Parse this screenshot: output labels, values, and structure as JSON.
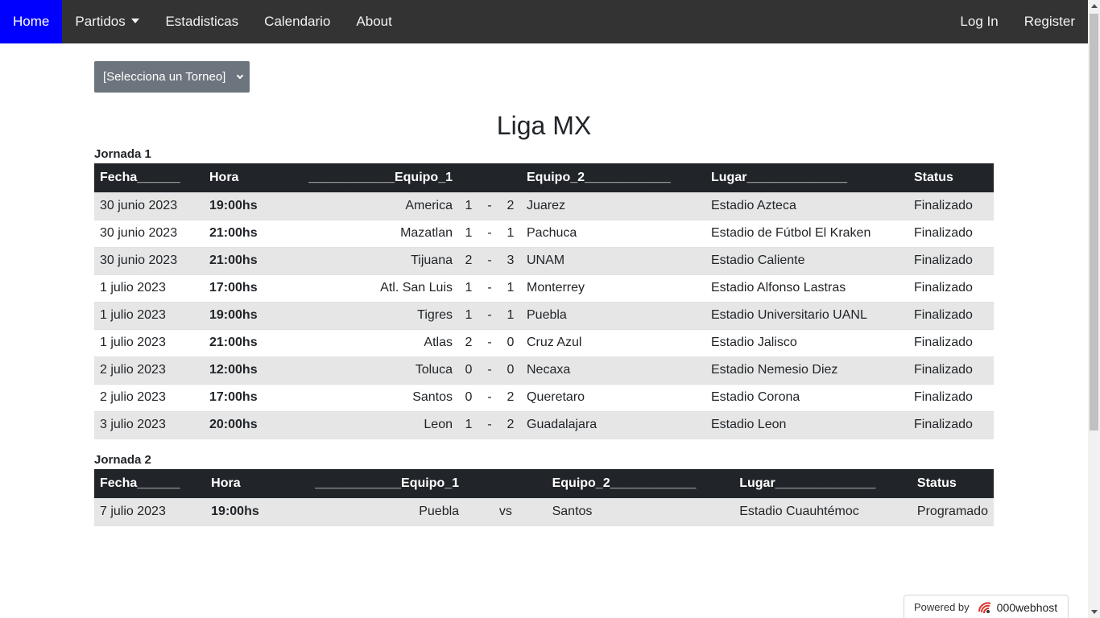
{
  "navbar": {
    "home": "Home",
    "partidos": "Partidos",
    "estadisticas": "Estadisticas",
    "calendario": "Calendario",
    "about": "About",
    "login": "Log In",
    "register": "Register"
  },
  "torneo_select": {
    "value": "[Selecciona un Torneo]"
  },
  "title": "Liga MX",
  "headers": {
    "fecha": "Fecha______",
    "hora": "Hora",
    "equipo1": "____________Equipo_1",
    "equipo2": "Equipo_2____________",
    "lugar": "Lugar______________",
    "status": "Status"
  },
  "jornadas": [
    {
      "label": "Jornada 1",
      "rows": [
        {
          "fecha": "30 junio 2023",
          "hora": "19:00hs",
          "equipo1": "America",
          "g1": "1",
          "sep": "-",
          "g2": "2",
          "equipo2": "Juarez",
          "lugar": "Estadio Azteca",
          "status": "Finalizado"
        },
        {
          "fecha": "30 junio 2023",
          "hora": "21:00hs",
          "equipo1": "Mazatlan",
          "g1": "1",
          "sep": "-",
          "g2": "1",
          "equipo2": "Pachuca",
          "lugar": "Estadio de Fútbol El Kraken",
          "status": "Finalizado"
        },
        {
          "fecha": "30 junio 2023",
          "hora": "21:00hs",
          "equipo1": "Tijuana",
          "g1": "2",
          "sep": "-",
          "g2": "3",
          "equipo2": "UNAM",
          "lugar": "Estadio Caliente",
          "status": "Finalizado"
        },
        {
          "fecha": "1 julio 2023",
          "hora": "17:00hs",
          "equipo1": "Atl. San Luis",
          "g1": "1",
          "sep": "-",
          "g2": "1",
          "equipo2": "Monterrey",
          "lugar": "Estadio Alfonso Lastras",
          "status": "Finalizado"
        },
        {
          "fecha": "1 julio 2023",
          "hora": "19:00hs",
          "equipo1": "Tigres",
          "g1": "1",
          "sep": "-",
          "g2": "1",
          "equipo2": "Puebla",
          "lugar": "Estadio Universitario UANL",
          "status": "Finalizado"
        },
        {
          "fecha": "1 julio 2023",
          "hora": "21:00hs",
          "equipo1": "Atlas",
          "g1": "2",
          "sep": "-",
          "g2": "0",
          "equipo2": "Cruz Azul",
          "lugar": "Estadio Jalisco",
          "status": "Finalizado"
        },
        {
          "fecha": "2 julio 2023",
          "hora": "12:00hs",
          "equipo1": "Toluca",
          "g1": "0",
          "sep": "-",
          "g2": "0",
          "equipo2": "Necaxa",
          "lugar": "Estadio Nemesio Diez",
          "status": "Finalizado"
        },
        {
          "fecha": "2 julio 2023",
          "hora": "17:00hs",
          "equipo1": "Santos",
          "g1": "0",
          "sep": "-",
          "g2": "2",
          "equipo2": "Queretaro",
          "lugar": "Estadio Corona",
          "status": "Finalizado"
        },
        {
          "fecha": "3 julio 2023",
          "hora": "20:00hs",
          "equipo1": "Leon",
          "g1": "1",
          "sep": "-",
          "g2": "2",
          "equipo2": "Guadalajara",
          "lugar": "Estadio Leon",
          "status": "Finalizado"
        }
      ]
    },
    {
      "label": "Jornada 2",
      "rows": [
        {
          "fecha": "7 julio 2023",
          "hora": "19:00hs",
          "equipo1": "Puebla",
          "vs": "vs",
          "equipo2": "Santos",
          "lugar": "Estadio Cuauhtémoc",
          "status": "Programado"
        }
      ]
    }
  ],
  "powered": {
    "prefix": "Powered by",
    "brand": "000webhost"
  },
  "colors": {
    "nav_bg": "#333333",
    "nav_active": "#0000ff",
    "table_head": "#212529",
    "row_stripe": "#e6e6e6",
    "select_bg": "#6c757d"
  }
}
